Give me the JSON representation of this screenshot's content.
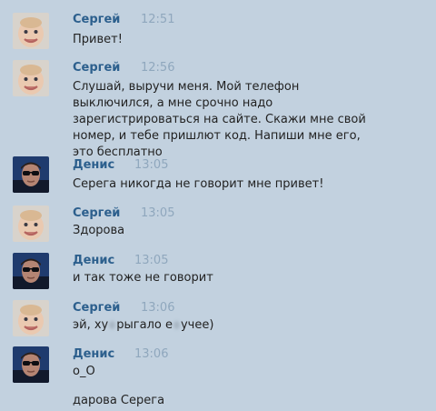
{
  "messages": [
    {
      "author": "Сергей",
      "time": "12:51",
      "avatar_icon": "baby-face-avatar-icon",
      "text": "Привет!"
    },
    {
      "author": "Сергей",
      "time": "12:56",
      "avatar_icon": "baby-face-avatar-icon",
      "text": "Слушай, выручи меня. Мой телефон выключился, а мне срочно надо зарегистрироваться на сайте. Скажи мне свой номер, и тебе пришлют код. Напиши мне его, это бесплатно"
    },
    {
      "author": "Денис",
      "time": "13:05",
      "avatar_icon": "sunglasses-avatar-icon",
      "text": "Серега никогда не говорит мне привет!"
    },
    {
      "author": "Сергей",
      "time": "13:05",
      "avatar_icon": "baby-face-avatar-icon",
      "text": "Здорова"
    },
    {
      "author": "Денис",
      "time": "13:05",
      "avatar_icon": "sunglasses-avatar-icon",
      "text": "и так тоже не говорит"
    },
    {
      "author": "Сергей",
      "time": "13:06",
      "avatar_icon": "baby-face-avatar-icon",
      "text_parts": [
        "эй, ху",
        "рыгало е",
        "учее)"
      ]
    },
    {
      "author": "Денис",
      "time": "13:06",
      "avatar_icon": "sunglasses-avatar-icon",
      "text": "о_О",
      "text_2": "дарова Серега"
    }
  ]
}
